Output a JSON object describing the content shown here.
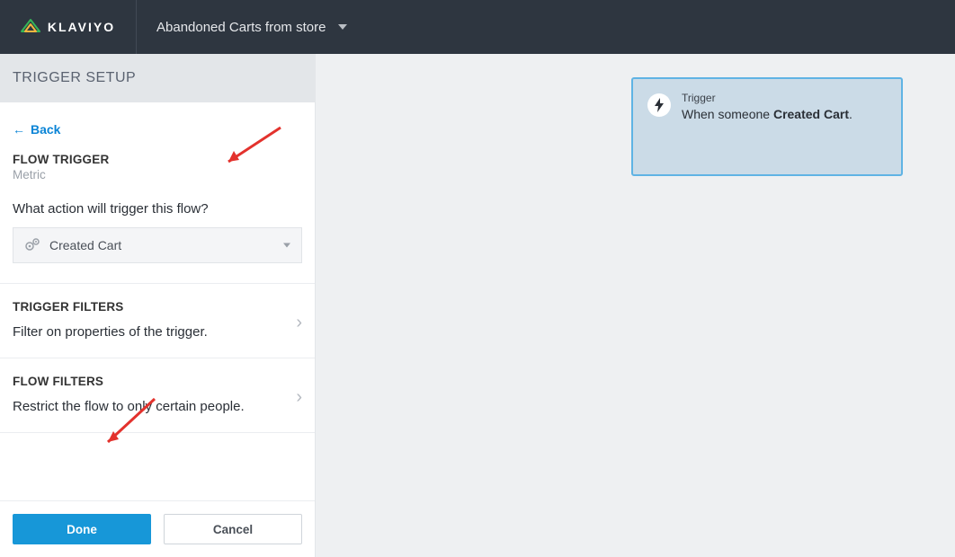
{
  "header": {
    "brand": "KLAVIYO",
    "flow_name": "Abandoned Carts from store"
  },
  "panel": {
    "title": "TRIGGER SETUP",
    "back_label": "Back",
    "flow_trigger": {
      "heading": "FLOW TRIGGER",
      "subtitle": "Metric",
      "question": "What action will trigger this flow?",
      "selected": "Created Cart"
    },
    "trigger_filters": {
      "heading": "TRIGGER FILTERS",
      "desc": "Filter on properties of the trigger."
    },
    "flow_filters": {
      "heading": "FLOW FILTERS",
      "desc": "Restrict the flow to only certain people."
    },
    "footer": {
      "done": "Done",
      "cancel": "Cancel"
    }
  },
  "canvas": {
    "trigger": {
      "label": "Trigger",
      "prefix": "When someone ",
      "metric": "Created Cart",
      "suffix": "."
    }
  }
}
